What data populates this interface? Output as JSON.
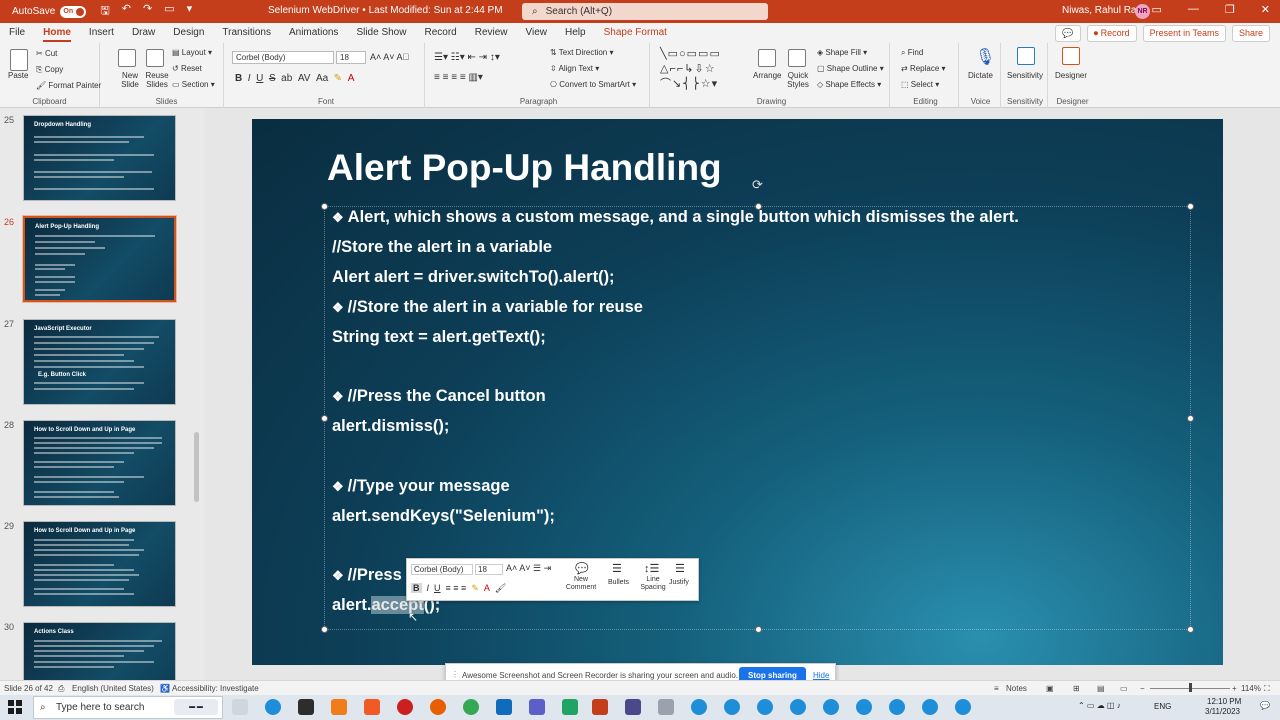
{
  "titlebar": {
    "autosave": "AutoSave",
    "toggle": "On",
    "doc_title": "Selenium WebDriver • Last Modified: Sun at 2:44 PM",
    "search_placeholder": "Search (Alt+Q)",
    "user": "Niwas, Rahul Ram",
    "initials": "NR"
  },
  "tabs": [
    "File",
    "Home",
    "Insert",
    "Draw",
    "Design",
    "Transitions",
    "Animations",
    "Slide Show",
    "Record",
    "Review",
    "View",
    "Help",
    "Shape Format"
  ],
  "header_buttons": {
    "record": "Record",
    "present": "Present in Teams",
    "share": "Share"
  },
  "ribbon": {
    "clipboard": {
      "paste": "Paste",
      "cut": "Cut",
      "copy": "Copy",
      "format_painter": "Format Painter",
      "label": "Clipboard"
    },
    "slides": {
      "new_slide": "New Slide",
      "reuse": "Reuse Slides",
      "layout": "Layout",
      "reset": "Reset",
      "section": "Section",
      "label": "Slides"
    },
    "font": {
      "name": "Corbel (Body)",
      "size": "18",
      "label": "Font"
    },
    "paragraph": {
      "text_direction": "Text Direction",
      "align_text": "Align Text",
      "smartart": "Convert to SmartArt",
      "label": "Paragraph"
    },
    "drawing": {
      "arrange": "Arrange",
      "quick_styles": "Quick Styles",
      "fill": "Shape Fill",
      "outline": "Shape Outline",
      "effects": "Shape Effects",
      "label": "Drawing"
    },
    "editing": {
      "find": "Find",
      "replace": "Replace",
      "select": "Select",
      "label": "Editing"
    },
    "voice": {
      "dictate": "Dictate",
      "label": "Voice"
    },
    "sensitivity": {
      "sensitivity": "Sensitivity",
      "label": "Sensitivity"
    },
    "designer": {
      "designer": "Designer",
      "label": "Designer"
    }
  },
  "thumbnails": [
    {
      "num": "25",
      "title": "Dropdown Handling"
    },
    {
      "num": "26",
      "title": "Alert Pop-Up Handling"
    },
    {
      "num": "27",
      "title": "JavaScript Executor",
      "extra": "E.g. Button Click"
    },
    {
      "num": "28",
      "title": "How to Scroll Down and Up in Page"
    },
    {
      "num": "29",
      "title": "How to Scroll Down and Up in Page"
    },
    {
      "num": "30",
      "title": "Actions Class"
    }
  ],
  "slide": {
    "title": "Alert Pop-Up Handling",
    "lines": {
      "l1": "Alert, which shows a custom message, and a single button which dismisses the alert.",
      "l2": "//Store the alert in a variable",
      "l3": "Alert alert = driver.switchTo().alert();",
      "l4": "//Store the alert in a variable for reuse",
      "l5": "String text = alert.getText();",
      "l6": "//Press the Cancel button",
      "l7": "alert.dismiss();",
      "l8": "//Type your message",
      "l9": "alert.sendKeys(\"Selenium\");",
      "l10": "//Press",
      "l11a": "alert.",
      "l11b": "accept",
      "l11c": "();"
    },
    "bullet": "❖"
  },
  "mini_toolbar": {
    "font": "Corbel (Body)",
    "size": "18",
    "new_comment": "New Comment",
    "bullets": "Bullets",
    "line_spacing": "Line Spacing",
    "justify": "Justify"
  },
  "sharebar": {
    "message": "Awesome Screenshot and Screen Recorder is sharing your screen and audio.",
    "stop": "Stop sharing",
    "hide": "Hide"
  },
  "statusbar": {
    "slide": "Slide 26 of 42",
    "lang": "English (United States)",
    "access": "Accessibility: Investigate",
    "notes": "Notes",
    "zoom": "114%"
  },
  "taskbar": {
    "search": "Type here to search",
    "lang": "ENG",
    "time": "12:10 PM",
    "date": "3/11/2023"
  }
}
